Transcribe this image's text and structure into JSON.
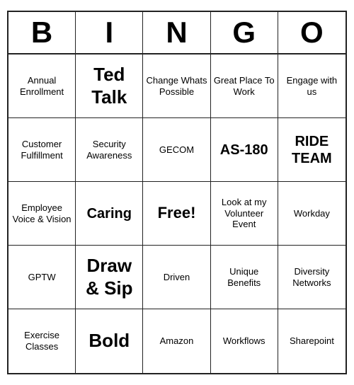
{
  "header": {
    "letters": [
      "B",
      "I",
      "N",
      "G",
      "O"
    ]
  },
  "cells": [
    {
      "text": "Annual Enrollment",
      "size": "normal"
    },
    {
      "text": "Ted Talk",
      "size": "large"
    },
    {
      "text": "Change Whats Possible",
      "size": "normal"
    },
    {
      "text": "Great Place To Work",
      "size": "normal"
    },
    {
      "text": "Engage with us",
      "size": "normal"
    },
    {
      "text": "Customer Fulfillment",
      "size": "normal"
    },
    {
      "text": "Security Awareness",
      "size": "normal"
    },
    {
      "text": "GECOM",
      "size": "normal"
    },
    {
      "text": "AS-180",
      "size": "medium-large"
    },
    {
      "text": "RIDE TEAM",
      "size": "medium-large"
    },
    {
      "text": "Employee Voice & Vision",
      "size": "normal"
    },
    {
      "text": "Caring",
      "size": "medium-large"
    },
    {
      "text": "Free!",
      "size": "free"
    },
    {
      "text": "Look at my Volunteer Event",
      "size": "normal"
    },
    {
      "text": "Workday",
      "size": "normal"
    },
    {
      "text": "GPTW",
      "size": "normal"
    },
    {
      "text": "Draw & Sip",
      "size": "large"
    },
    {
      "text": "Driven",
      "size": "normal"
    },
    {
      "text": "Unique Benefits",
      "size": "normal"
    },
    {
      "text": "Diversity Networks",
      "size": "normal"
    },
    {
      "text": "Exercise Classes",
      "size": "normal"
    },
    {
      "text": "Bold",
      "size": "large"
    },
    {
      "text": "Amazon",
      "size": "normal"
    },
    {
      "text": "Workflows",
      "size": "normal"
    },
    {
      "text": "Sharepoint",
      "size": "normal"
    }
  ]
}
